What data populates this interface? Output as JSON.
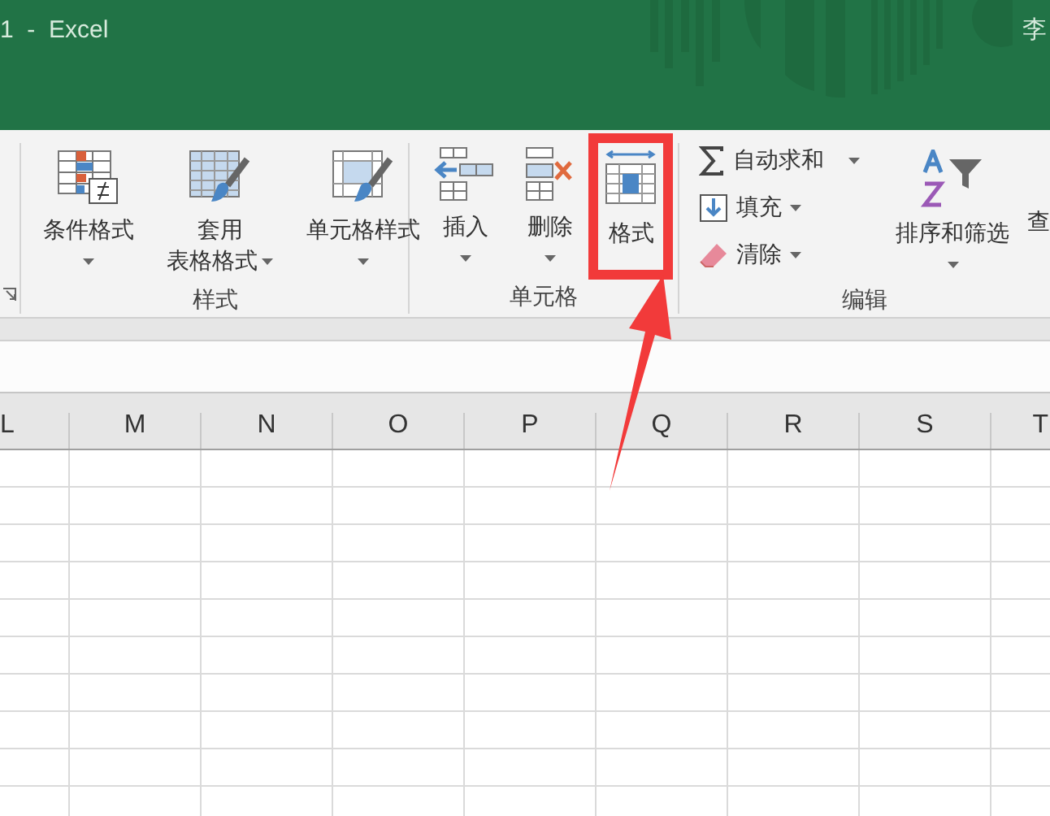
{
  "window": {
    "title": "1  -  Excel",
    "user": "李"
  },
  "ribbon": {
    "groups": [
      {
        "label": "样式",
        "buttons": [
          {
            "kind": "large",
            "lines": [
              "条件格式"
            ],
            "highlighted": false
          },
          {
            "kind": "large",
            "lines": [
              "套用",
              "表格格式"
            ],
            "highlighted": false
          },
          {
            "kind": "large",
            "lines": [
              "单元格样式"
            ],
            "highlighted": false
          }
        ]
      },
      {
        "label": "单元格",
        "buttons": [
          {
            "kind": "large",
            "lines": [
              "插入"
            ],
            "highlighted": false
          },
          {
            "kind": "large",
            "lines": [
              "删除"
            ],
            "highlighted": false
          },
          {
            "kind": "large",
            "lines": [
              "格式"
            ],
            "highlighted": true
          }
        ]
      },
      {
        "label": "编辑",
        "buttons": [
          {
            "kind": "small",
            "lines": [
              "自动求和"
            ],
            "highlighted": false
          },
          {
            "kind": "small",
            "lines": [
              "填充"
            ],
            "highlighted": false
          },
          {
            "kind": "small",
            "lines": [
              "清除"
            ],
            "highlighted": false
          },
          {
            "kind": "large",
            "lines": [
              "排序和筛选"
            ],
            "highlighted": false
          },
          {
            "kind": "partial",
            "lines": [
              "查"
            ]
          }
        ]
      }
    ]
  },
  "columns": [
    "L",
    "M",
    "N",
    "O",
    "P",
    "Q",
    "R",
    "S",
    "T"
  ]
}
